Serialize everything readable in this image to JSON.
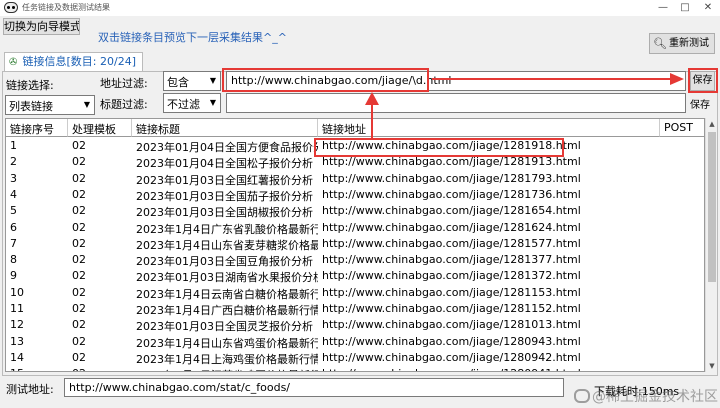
{
  "window": {
    "title": "任务链接及数据测试结果",
    "min_glyph": "—",
    "max_glyph": "□",
    "close_glyph": "✕"
  },
  "toolbar": {
    "switch_mode_label": "切换为向导模式",
    "hint_text": "双击链接条目预览下一层采集结果^_^",
    "retest_label": "重新测试",
    "retest_icon": "magnifier-icon"
  },
  "tab": {
    "label": "链接信息[数目: 20/24]",
    "icon": "link-icon"
  },
  "filters": {
    "link_select_label": "链接选择:",
    "link_select_value": "列表链接",
    "url_filter_label": "地址过滤:",
    "url_filter_mode": "包含",
    "url_filter_value": "http://www.chinabgao.com/jiage/\\d.html",
    "save1_label": "保存",
    "title_filter_label": "标题过滤:",
    "title_filter_mode": "不过滤",
    "title_filter_value": "",
    "save2_label": "保存"
  },
  "table": {
    "columns": [
      "链接序号",
      "处理模板",
      "链接标题",
      "链接地址",
      "POST"
    ],
    "rows": [
      {
        "no": "1",
        "tpl": "02",
        "title": "2023年01月04日全国方便食品报价分...",
        "url": "http://www.chinabgao.com/jiage/1281918.html"
      },
      {
        "no": "2",
        "tpl": "02",
        "title": "2023年01月04日全国松子报价分析",
        "url": "http://www.chinabgao.com/jiage/1281913.html"
      },
      {
        "no": "3",
        "tpl": "02",
        "title": "2023年01月03日全国红薯报价分析",
        "url": "http://www.chinabgao.com/jiage/1281793.html"
      },
      {
        "no": "4",
        "tpl": "02",
        "title": "2023年01月03日全国茄子报价分析",
        "url": "http://www.chinabgao.com/jiage/1281736.html"
      },
      {
        "no": "5",
        "tpl": "02",
        "title": "2023年01月03日全国胡椒报价分析",
        "url": "http://www.chinabgao.com/jiage/1281654.html"
      },
      {
        "no": "6",
        "tpl": "02",
        "title": "2023年1月4日广东省乳酸价格最新行...",
        "url": "http://www.chinabgao.com/jiage/1281624.html"
      },
      {
        "no": "7",
        "tpl": "02",
        "title": "2023年1月4日山东省麦芽糖浆价格最...",
        "url": "http://www.chinabgao.com/jiage/1281577.html"
      },
      {
        "no": "8",
        "tpl": "02",
        "title": "2023年01月03日全国豆角报价分析",
        "url": "http://www.chinabgao.com/jiage/1281377.html"
      },
      {
        "no": "9",
        "tpl": "02",
        "title": "2023年01月03日湖南省水果报价分析",
        "url": "http://www.chinabgao.com/jiage/1281372.html"
      },
      {
        "no": "10",
        "tpl": "02",
        "title": "2023年1月4日云南省白糖价格最新行...",
        "url": "http://www.chinabgao.com/jiage/1281153.html"
      },
      {
        "no": "11",
        "tpl": "02",
        "title": "2023年1月4日广西白糖价格最新行情...",
        "url": "http://www.chinabgao.com/jiage/1281152.html"
      },
      {
        "no": "12",
        "tpl": "02",
        "title": "2023年01月03日全国灵芝报价分析",
        "url": "http://www.chinabgao.com/jiage/1281013.html"
      },
      {
        "no": "13",
        "tpl": "02",
        "title": "2023年1月4日山东省鸡蛋价格最新行...",
        "url": "http://www.chinabgao.com/jiage/1280943.html"
      },
      {
        "no": "14",
        "tpl": "02",
        "title": "2023年1月4日上海鸡蛋价格最新行情...",
        "url": "http://www.chinabgao.com/jiage/1280942.html"
      },
      {
        "no": "15",
        "tpl": "02",
        "title": "2023年1月4日江苏省鸡蛋价格最新行...",
        "url": "http://www.chinabgao.com/jiage/1280941.html"
      }
    ]
  },
  "status": {
    "test_url_label": "测试地址:",
    "test_url_value": "http://www.chinabgao.com/stat/c_foods/",
    "download_time": "下载耗时:150ms"
  },
  "watermark": {
    "text": "@稀土掘金技术社区"
  },
  "colors": {
    "annotation_red": "#e53935",
    "hint_blue": "#2a63b8",
    "tab_blue": "#1a5fb4"
  }
}
